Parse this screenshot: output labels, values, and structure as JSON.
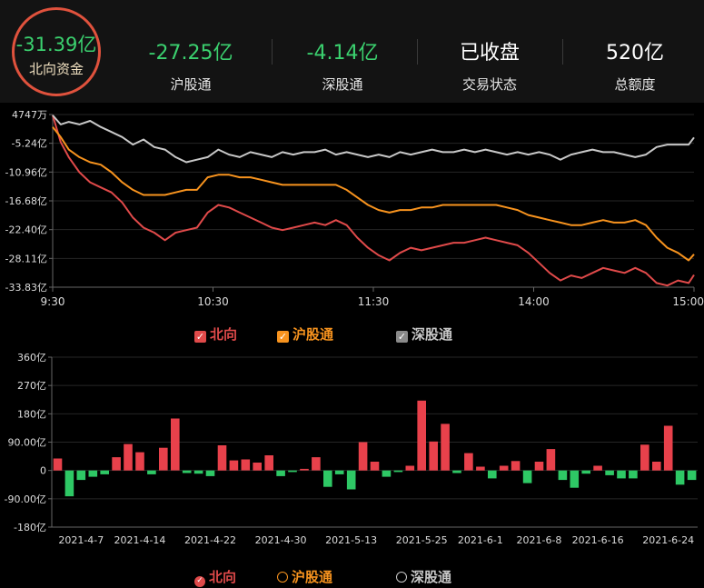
{
  "header": {
    "north_value": "-31.39亿",
    "north_label": "北向资金",
    "stats": [
      {
        "value": "-27.25亿",
        "label": "沪股通",
        "color": "#3bd16f"
      },
      {
        "value": "-4.14亿",
        "label": "深股通",
        "color": "#3bd16f"
      },
      {
        "value": "已收盘",
        "label": "交易状态",
        "color": "#ffffff"
      },
      {
        "value": "520亿",
        "label": "总额度",
        "color": "#ffffff"
      }
    ]
  },
  "colors": {
    "north": "#e04a4a",
    "sh": "#f7931e",
    "sz": "#c8c8c8",
    "pos": "#e8414b",
    "neg": "#2ec865"
  },
  "chart_data": [
    {
      "type": "line",
      "y_tick_labels": [
        "4747万",
        "-5.24亿",
        "-10.96亿",
        "-16.68亿",
        "-22.40亿",
        "-28.11亿",
        "-33.83亿"
      ],
      "y_ticks": [
        0.47,
        -5.24,
        -10.96,
        -16.68,
        -22.4,
        -28.11,
        -33.83
      ],
      "ylim": [
        -33.83,
        0.47
      ],
      "x_tick_labels": [
        "9:30",
        "10:30",
        "11:30",
        "14:00",
        "15:00"
      ],
      "x_ticks": [
        0,
        60,
        120,
        180,
        240
      ],
      "xlim": [
        0,
        240
      ],
      "series": [
        {
          "name": "北向",
          "points": [
            [
              0,
              0.3
            ],
            [
              3,
              -5
            ],
            [
              6,
              -8
            ],
            [
              10,
              -11
            ],
            [
              14,
              -13
            ],
            [
              18,
              -14
            ],
            [
              22,
              -15
            ],
            [
              26,
              -17
            ],
            [
              30,
              -20
            ],
            [
              34,
              -22
            ],
            [
              38,
              -23
            ],
            [
              42,
              -24.5
            ],
            [
              46,
              -23
            ],
            [
              50,
              -22.5
            ],
            [
              54,
              -22
            ],
            [
              58,
              -19
            ],
            [
              62,
              -17.5
            ],
            [
              66,
              -18
            ],
            [
              70,
              -19
            ],
            [
              74,
              -20
            ],
            [
              78,
              -21
            ],
            [
              82,
              -22
            ],
            [
              86,
              -22.5
            ],
            [
              90,
              -22
            ],
            [
              94,
              -21.5
            ],
            [
              98,
              -21
            ],
            [
              102,
              -21.5
            ],
            [
              106,
              -20.5
            ],
            [
              110,
              -21.5
            ],
            [
              114,
              -24
            ],
            [
              118,
              -26
            ],
            [
              122,
              -27.5
            ],
            [
              126,
              -28.5
            ],
            [
              130,
              -27
            ],
            [
              134,
              -26
            ],
            [
              138,
              -26.5
            ],
            [
              142,
              -26
            ],
            [
              146,
              -25.5
            ],
            [
              150,
              -25
            ],
            [
              154,
              -25
            ],
            [
              158,
              -24.5
            ],
            [
              162,
              -24
            ],
            [
              166,
              -24.5
            ],
            [
              170,
              -25
            ],
            [
              174,
              -25.5
            ],
            [
              178,
              -27
            ],
            [
              182,
              -29
            ],
            [
              186,
              -31
            ],
            [
              190,
              -32.5
            ],
            [
              194,
              -31.5
            ],
            [
              198,
              -32
            ],
            [
              202,
              -31
            ],
            [
              206,
              -30
            ],
            [
              210,
              -30.5
            ],
            [
              214,
              -31
            ],
            [
              218,
              -30
            ],
            [
              222,
              -31
            ],
            [
              226,
              -33
            ],
            [
              230,
              -33.5
            ],
            [
              234,
              -32.5
            ],
            [
              238,
              -33
            ],
            [
              240,
              -31.4
            ]
          ]
        },
        {
          "name": "沪股通",
          "points": [
            [
              0,
              -2
            ],
            [
              3,
              -4
            ],
            [
              6,
              -6.5
            ],
            [
              10,
              -8
            ],
            [
              14,
              -9
            ],
            [
              18,
              -9.5
            ],
            [
              22,
              -11
            ],
            [
              26,
              -13
            ],
            [
              30,
              -14.5
            ],
            [
              34,
              -15.5
            ],
            [
              38,
              -15.5
            ],
            [
              42,
              -15.5
            ],
            [
              46,
              -15
            ],
            [
              50,
              -14.5
            ],
            [
              54,
              -14.5
            ],
            [
              58,
              -12
            ],
            [
              62,
              -11.5
            ],
            [
              66,
              -11.5
            ],
            [
              70,
              -12
            ],
            [
              74,
              -12
            ],
            [
              78,
              -12.5
            ],
            [
              82,
              -13
            ],
            [
              86,
              -13.5
            ],
            [
              90,
              -13.5
            ],
            [
              94,
              -13.5
            ],
            [
              98,
              -13.5
            ],
            [
              102,
              -13.5
            ],
            [
              106,
              -13.5
            ],
            [
              110,
              -14.5
            ],
            [
              114,
              -16
            ],
            [
              118,
              -17.5
            ],
            [
              122,
              -18.5
            ],
            [
              126,
              -19
            ],
            [
              130,
              -18.5
            ],
            [
              134,
              -18.5
            ],
            [
              138,
              -18
            ],
            [
              142,
              -18
            ],
            [
              146,
              -17.5
            ],
            [
              150,
              -17.5
            ],
            [
              154,
              -17.5
            ],
            [
              158,
              -17.5
            ],
            [
              162,
              -17.5
            ],
            [
              166,
              -17.5
            ],
            [
              170,
              -18
            ],
            [
              174,
              -18.5
            ],
            [
              178,
              -19.5
            ],
            [
              182,
              -20
            ],
            [
              186,
              -20.5
            ],
            [
              190,
              -21
            ],
            [
              194,
              -21.5
            ],
            [
              198,
              -21.5
            ],
            [
              202,
              -21
            ],
            [
              206,
              -20.5
            ],
            [
              210,
              -21
            ],
            [
              214,
              -21
            ],
            [
              218,
              -20.5
            ],
            [
              222,
              -21.5
            ],
            [
              226,
              -24
            ],
            [
              230,
              -26
            ],
            [
              234,
              -27
            ],
            [
              238,
              -28.5
            ],
            [
              240,
              -27.3
            ]
          ]
        },
        {
          "name": "深股通",
          "points": [
            [
              0,
              0.3
            ],
            [
              3,
              -1.5
            ],
            [
              6,
              -1
            ],
            [
              10,
              -1.5
            ],
            [
              14,
              -0.8
            ],
            [
              18,
              -2
            ],
            [
              22,
              -3
            ],
            [
              26,
              -4
            ],
            [
              30,
              -5.5
            ],
            [
              34,
              -4.5
            ],
            [
              38,
              -6
            ],
            [
              42,
              -6.5
            ],
            [
              46,
              -8
            ],
            [
              50,
              -9
            ],
            [
              54,
              -8.5
            ],
            [
              58,
              -8
            ],
            [
              62,
              -6.5
            ],
            [
              66,
              -7.5
            ],
            [
              70,
              -8
            ],
            [
              74,
              -7
            ],
            [
              78,
              -7.5
            ],
            [
              82,
              -8
            ],
            [
              86,
              -7
            ],
            [
              90,
              -7.5
            ],
            [
              94,
              -7
            ],
            [
              98,
              -7
            ],
            [
              102,
              -6.5
            ],
            [
              106,
              -7.5
            ],
            [
              110,
              -7
            ],
            [
              114,
              -7.5
            ],
            [
              118,
              -8
            ],
            [
              122,
              -7.5
            ],
            [
              126,
              -8
            ],
            [
              130,
              -7
            ],
            [
              134,
              -7.5
            ],
            [
              138,
              -7
            ],
            [
              142,
              -6.5
            ],
            [
              146,
              -7
            ],
            [
              150,
              -7
            ],
            [
              154,
              -6.5
            ],
            [
              158,
              -7
            ],
            [
              162,
              -6.5
            ],
            [
              166,
              -7
            ],
            [
              170,
              -7.5
            ],
            [
              174,
              -7
            ],
            [
              178,
              -7.5
            ],
            [
              182,
              -7
            ],
            [
              186,
              -7.5
            ],
            [
              190,
              -8.5
            ],
            [
              194,
              -7.5
            ],
            [
              198,
              -7
            ],
            [
              202,
              -6.5
            ],
            [
              206,
              -7
            ],
            [
              210,
              -7
            ],
            [
              214,
              -7.5
            ],
            [
              218,
              -8
            ],
            [
              222,
              -7.5
            ],
            [
              226,
              -6
            ],
            [
              230,
              -5.5
            ],
            [
              234,
              -5.5
            ],
            [
              238,
              -5.5
            ],
            [
              240,
              -4.1
            ]
          ]
        }
      ]
    },
    {
      "type": "bar",
      "y_tick_labels": [
        "360亿",
        "270亿",
        "180亿",
        "90.00亿",
        "0",
        "-90.00亿",
        "-180亿"
      ],
      "y_ticks": [
        360,
        270,
        180,
        90,
        0,
        -90,
        -180
      ],
      "ylim": [
        -180,
        360
      ],
      "x_tick_labels": [
        "2021-4-7",
        "2021-4-14",
        "2021-4-22",
        "2021-4-30",
        "2021-5-13",
        "2021-5-25",
        "2021-6-1",
        "2021-6-8",
        "2021-6-16",
        "2021-6-24"
      ],
      "x_tick_index": [
        2,
        7,
        13,
        19,
        25,
        31,
        36,
        41,
        46,
        52
      ],
      "values": [
        38,
        -82,
        -30,
        -20,
        -12,
        42,
        84,
        58,
        -12,
        72,
        165,
        -8,
        -10,
        -18,
        80,
        32,
        35,
        25,
        48,
        -18,
        -5,
        5,
        42,
        -52,
        -12,
        -60,
        90,
        28,
        -20,
        -5,
        15,
        222,
        92,
        148,
        -8,
        55,
        12,
        -25,
        15,
        30,
        -40,
        28,
        68,
        -30,
        -55,
        -10,
        15,
        -15,
        -25,
        -25,
        82,
        28,
        142,
        -45,
        -30
      ],
      "legend": [
        "北向",
        "沪股通",
        "深股通"
      ]
    }
  ]
}
